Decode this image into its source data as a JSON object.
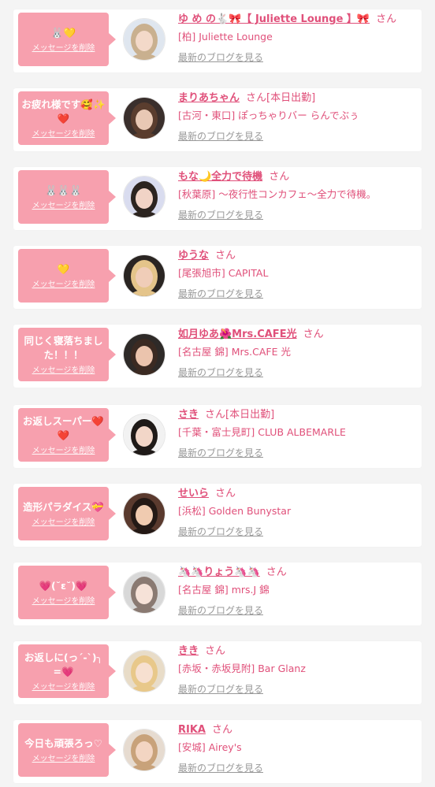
{
  "delete_label": "メッセージを削除",
  "blog_label": "最新のブログを見る",
  "san_label": "さん",
  "colors": {
    "page_bg": "#f4f4f4",
    "bubble": "#f7a0ae",
    "accent": "#e0507a",
    "muted": "#999999"
  },
  "items": [
    {
      "message": "🐰💛",
      "name": "ゆ め の🐇🎀【 Juliette Lounge 】🎀",
      "status": "",
      "shop": "[柏] Juliette Lounge",
      "avatar_icon": "avatar-photo"
    },
    {
      "message": "お疲れ様です🥰✨❤️",
      "name": "まりあちゃん",
      "status": "[本日出勤]",
      "shop": "[古河・東口] ぽっちゃりバー らんでぶぅ",
      "avatar_icon": "avatar-photo"
    },
    {
      "message": "🐰🐰🐰",
      "name": "もな🌙全力で待機",
      "status": "",
      "shop": "[秋葉原] 〜夜行性コンカフェ〜全力で待機。",
      "avatar_icon": "avatar-photo"
    },
    {
      "message": "💛",
      "name": "ゆうな",
      "status": "",
      "shop": "[尾張旭市] CAPITAL",
      "avatar_icon": "avatar-photo"
    },
    {
      "message": "同じく寝落ちました！！！",
      "name": "如月ゆあ🌺Mrs.CAFE光",
      "status": "",
      "shop": "[名古屋 錦] Mrs.CAFE 光",
      "avatar_icon": "avatar-photo"
    },
    {
      "message": "お返しスーパー❤️❤️",
      "name": "さき",
      "status": "[本日出勤]",
      "shop": "[千葉・富士見町] CLUB ALBEMARLE",
      "avatar_icon": "avatar-photo"
    },
    {
      "message": "造形パラダイス💝",
      "name": "せいら",
      "status": "",
      "shop": "[浜松] Golden Bunystar",
      "avatar_icon": "avatar-photo"
    },
    {
      "message": "💗(˘ε˘)💗",
      "name": "🦄🦄りょう🦄🦄",
      "status": "",
      "shop": "[名古屋 錦] mrs.J 錦",
      "avatar_icon": "avatar-photo"
    },
    {
      "message": "お返しに(っ´-`)╮ =💗",
      "name": "きき",
      "status": "",
      "shop": "[赤坂・赤坂見附] Bar Glanz",
      "avatar_icon": "avatar-photo"
    },
    {
      "message": "今日も頑張ろっ♡",
      "name": "RIKA",
      "status": "",
      "shop": "[安城] Airey's",
      "avatar_icon": "avatar-photo"
    }
  ]
}
